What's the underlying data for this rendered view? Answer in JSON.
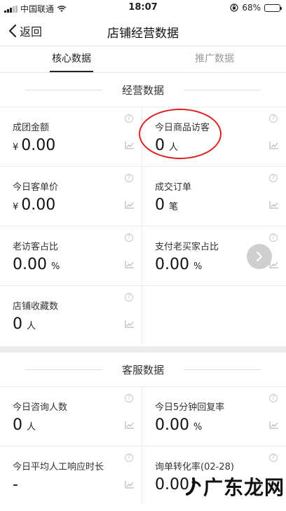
{
  "status_bar": {
    "carrier": "中国联通",
    "time": "18:07",
    "battery": "68%",
    "battery_level": 0.68
  },
  "nav": {
    "back_label": "返回",
    "title": "店铺经营数据"
  },
  "tabs": [
    {
      "label": "核心数据",
      "active": true
    },
    {
      "label": "推广数据",
      "active": false
    }
  ],
  "business_section": {
    "title": "经营数据",
    "cells": [
      {
        "label": "成团金额",
        "prefix": "¥",
        "value": "0.00",
        "unit": ""
      },
      {
        "label": "今日商品访客",
        "prefix": "",
        "value": "0",
        "unit": "人"
      },
      {
        "label": "今日客单价",
        "prefix": "¥",
        "value": "0.00",
        "unit": ""
      },
      {
        "label": "成交订单",
        "prefix": "",
        "value": "0",
        "unit": "笔"
      },
      {
        "label": "老访客占比",
        "prefix": "",
        "value": "0.00",
        "unit": "%"
      },
      {
        "label": "支付老买家占比",
        "prefix": "",
        "value": "0.00",
        "unit": "%"
      },
      {
        "label": "店铺收藏数",
        "prefix": "",
        "value": "0",
        "unit": "人"
      }
    ]
  },
  "service_section": {
    "title": "客服数据",
    "cells": [
      {
        "label": "今日咨询人数",
        "prefix": "",
        "value": "0",
        "unit": "人"
      },
      {
        "label": "今日5分钟回复率",
        "prefix": "",
        "value": "0.00",
        "unit": "%"
      },
      {
        "label": "今日平均人工响应时长",
        "prefix": "",
        "value": "-",
        "unit": ""
      },
      {
        "label": "询单转化率(02-28)",
        "prefix": "",
        "value": "0.00",
        "unit": ""
      }
    ]
  },
  "icons": {
    "help": "question-circle-icon",
    "trend": "line-chart-icon",
    "next": "chevron-right-icon"
  },
  "colors": {
    "annotation_circle": "#e02020"
  },
  "watermark": {
    "text": "广东龙网"
  }
}
